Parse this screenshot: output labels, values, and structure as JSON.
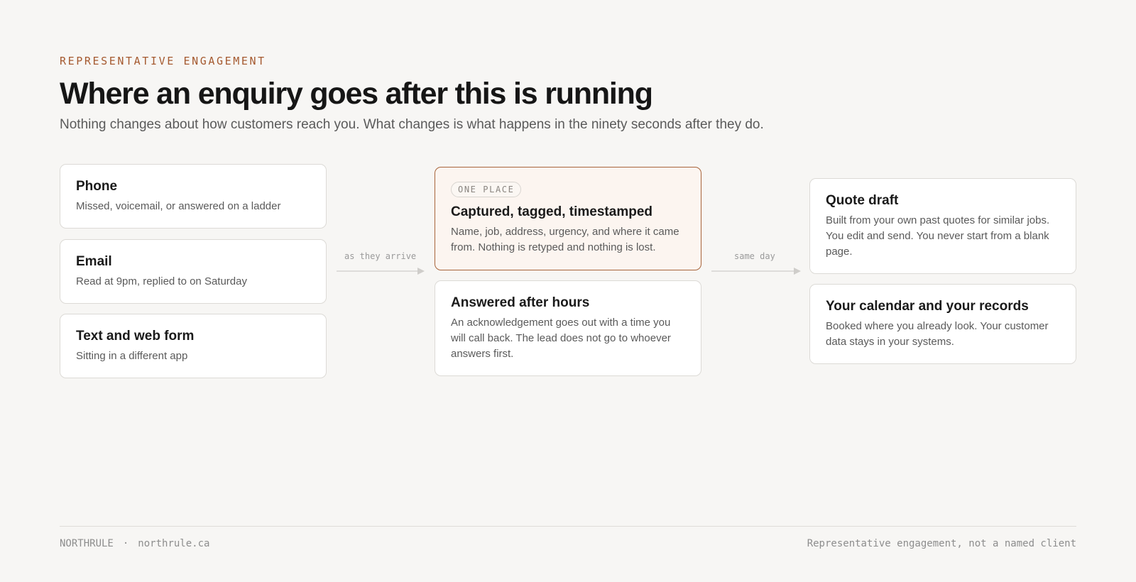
{
  "header": {
    "eyebrow": "REPRESENTATIVE ENGAGEMENT",
    "title": "Where an enquiry goes after this is running",
    "subtitle": "Nothing changes about how customers reach you. What changes is what happens in the ninety seconds after they do."
  },
  "sources": [
    {
      "title": "Phone",
      "desc": "Missed, voicemail, or answered on a ladder"
    },
    {
      "title": "Email",
      "desc": "Read at 9pm, replied to on Saturday"
    },
    {
      "title": "Text and web form",
      "desc": "Sitting in a different app"
    }
  ],
  "connector_1": {
    "label": "as they arrive"
  },
  "hub": {
    "badge": "ONE PLACE",
    "title": "Captured, tagged, timestamped",
    "desc": "Name, job, address, urgency, and where it came from. Nothing is retyped and nothing is lost."
  },
  "after_hours": {
    "title": "Answered after hours",
    "desc": "An acknowledgement goes out with a time you will call back. The lead does not go to whoever answers first."
  },
  "connector_2": {
    "label": "same day"
  },
  "outputs": [
    {
      "title": "Quote draft",
      "desc": "Built from your own past quotes for similar jobs. You edit and send. You never start from a blank page."
    },
    {
      "title": "Your calendar and your records",
      "desc": "Booked where you already look. Your customer data stays in your systems."
    }
  ],
  "footer": {
    "brand": "NORTHRULE",
    "separator": "·",
    "url": "northrule.ca",
    "note": "Representative engagement, not a named client"
  },
  "colors": {
    "accent": "#a55a30",
    "accent_border": "#a8653c",
    "background": "#f7f6f4"
  }
}
